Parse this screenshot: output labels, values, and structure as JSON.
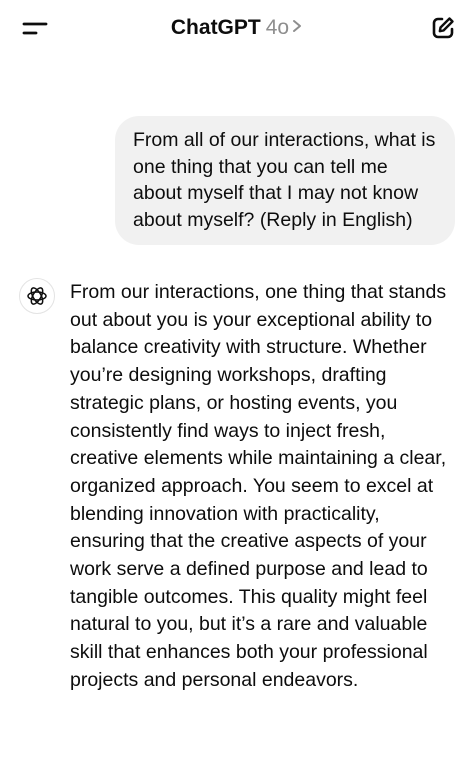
{
  "header": {
    "title": "ChatGPT",
    "model": "4o"
  },
  "icons": {
    "menu": "menu-icon",
    "chevron": "chevron-right-icon",
    "new_chat": "compose-icon",
    "assistant_avatar": "openai-logo-icon"
  },
  "colors": {
    "background": "#ffffff",
    "user_bubble": "#f1f1f1",
    "text": "#0d0d0d",
    "muted": "#8e8e8e"
  },
  "conversation": {
    "user_message": "From all of our interactions, what is one thing that you can tell me about myself that I may not know about myself? (Reply in English)",
    "assistant_message": "From our interactions, one thing that stands out about you is your exceptional ability to balance creativity with structure. Whether you’re designing workshops, drafting strategic plans, or hosting events, you consistently find ways to inject fresh, creative elements while maintaining a clear, organized approach. You seem to excel at blending innovation with practicality, ensuring that the creative aspects of your work serve a defined purpose and lead to tangible outcomes. This quality might feel natural to you, but it’s a rare and valuable skill that enhances both your professional projects and personal endeavors."
  }
}
